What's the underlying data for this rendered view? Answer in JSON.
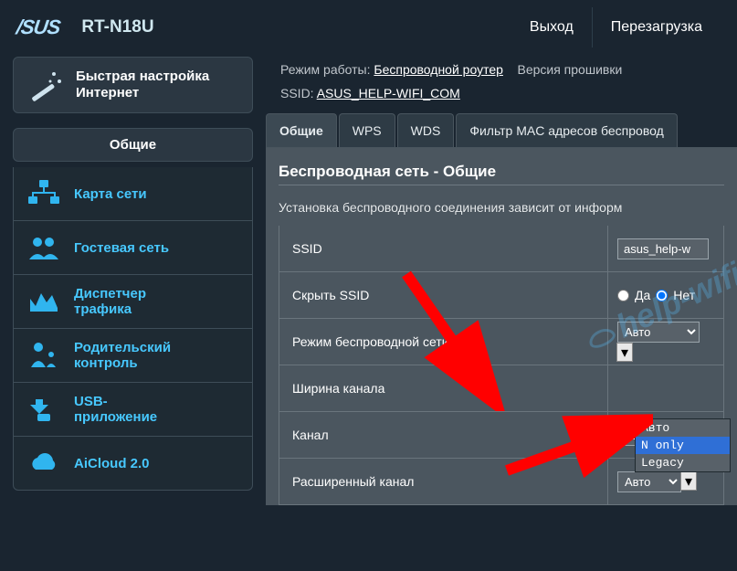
{
  "header": {
    "brand": "/SUS",
    "model": "RT-N18U",
    "logout": "Выход",
    "reboot": "Перезагрузка"
  },
  "sidebar": {
    "quick_setup_line1": "Быстрая настройка",
    "quick_setup_line2": "Интернет",
    "section": "Общие",
    "items": [
      {
        "label": "Карта сети"
      },
      {
        "label": "Гостевая сеть"
      },
      {
        "label": "Диспетчер\nтрафика"
      },
      {
        "label": "Родительский\nконтроль"
      },
      {
        "label": "USB-\nприложение"
      },
      {
        "label": "AiCloud 2.0"
      }
    ]
  },
  "meta": {
    "mode_label": "Режим работы:",
    "mode_value": "Беспроводной роутер",
    "fw_label": "Версия прошивки",
    "ssid_label": "SSID:",
    "ssid_value": "ASUS_HELP-WIFI_COM"
  },
  "tabs": [
    {
      "label": "Общие",
      "active": true
    },
    {
      "label": "WPS",
      "active": false
    },
    {
      "label": "WDS",
      "active": false
    },
    {
      "label": "Фильтр MAC адресов беспровод",
      "active": false
    }
  ],
  "panel": {
    "title": "Беспроводная сеть - Общие",
    "desc": "Установка беспроводного соединения зависит от информ",
    "rows": {
      "ssid_label": "SSID",
      "ssid_value": "asus_help-w",
      "hide_ssid_label": "Скрыть SSID",
      "hide_yes": "Да",
      "hide_no": "Нет",
      "hide_value": "no",
      "mode_label": "Режим беспроводной сети",
      "mode_value": "Авто",
      "mode_options": [
        "Авто",
        "N only",
        "Legacy"
      ],
      "width_label": "Ширина канала",
      "channel_label": "Канал",
      "channel_value": "Авто",
      "ext_channel_label": "Расширенный канал",
      "ext_channel_value": "Авто"
    }
  },
  "watermark": "help-wifi.c"
}
